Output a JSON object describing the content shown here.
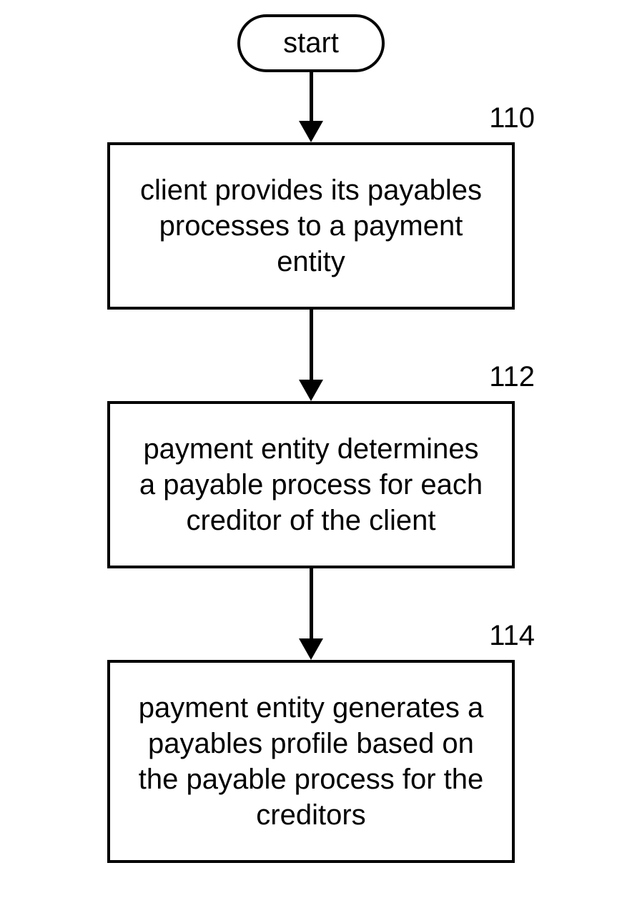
{
  "flowchart": {
    "start": {
      "label": "start"
    },
    "steps": [
      {
        "ref": "110",
        "text": "client provides its payables processes to a payment entity"
      },
      {
        "ref": "112",
        "text": "payment entity determines a payable process for each creditor of the client"
      },
      {
        "ref": "114",
        "text": "payment entity generates a payables profile based on the payable process for the creditors"
      }
    ]
  }
}
